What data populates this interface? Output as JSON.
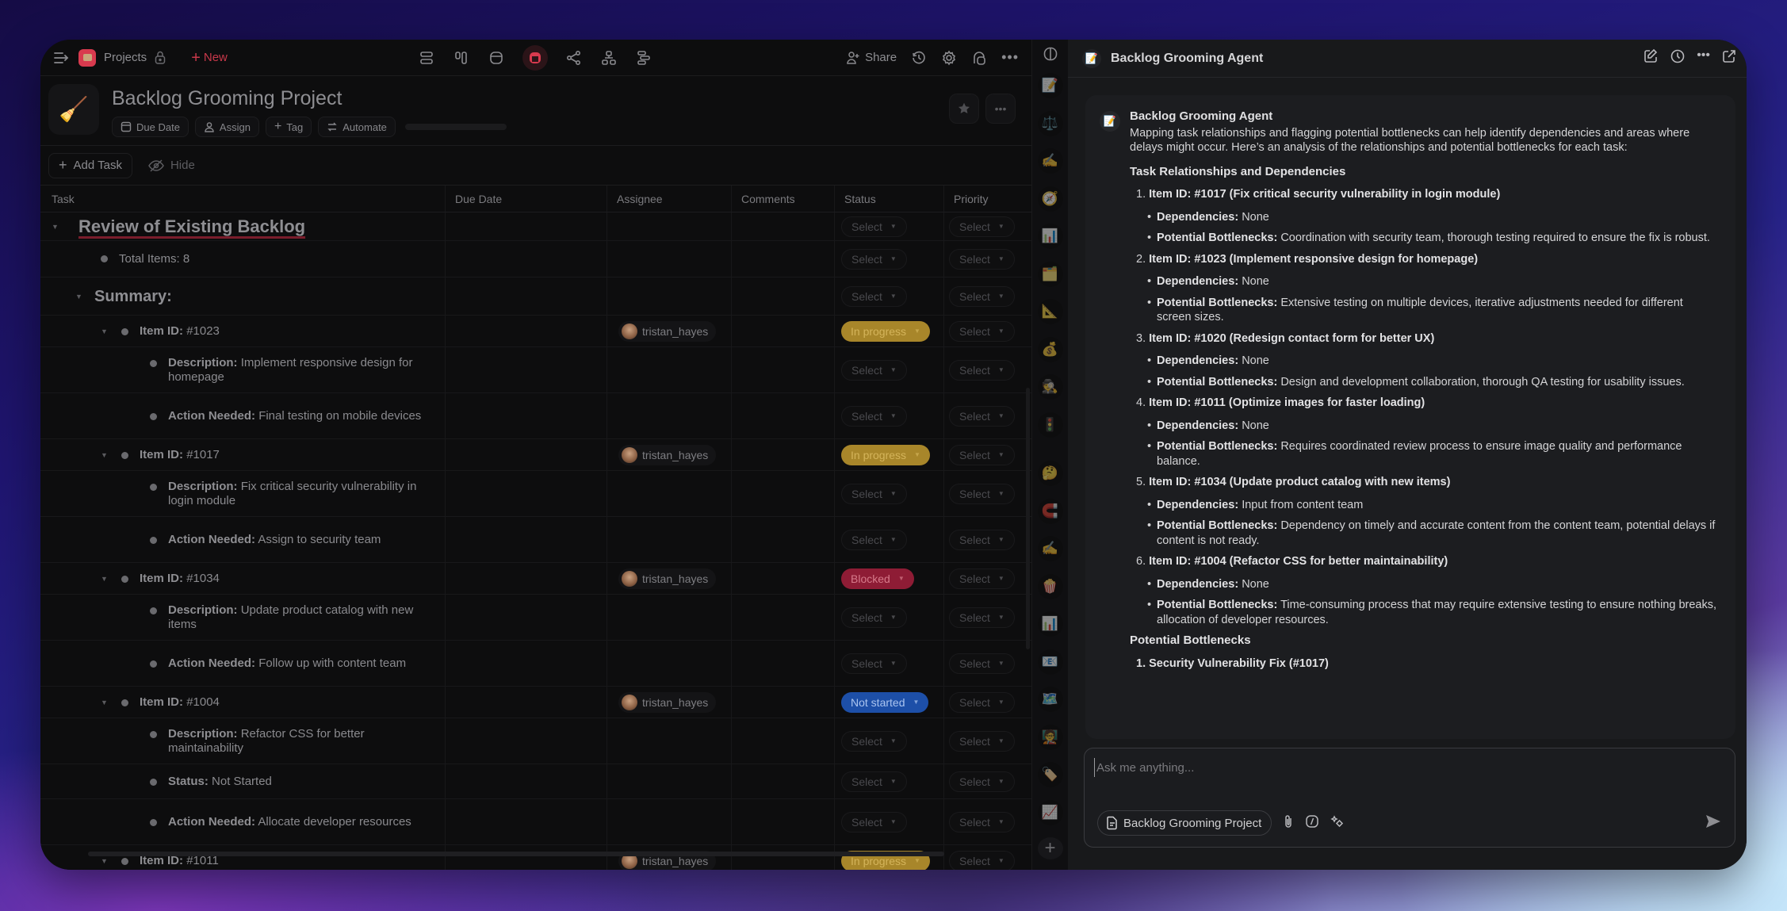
{
  "topbar": {
    "workspace_label": "Projects",
    "new_label": "New",
    "share_label": "Share",
    "views": [
      "list-view",
      "board-view",
      "calendar-view",
      "table-view",
      "graph-view",
      "hierarchy-view",
      "gantt-view"
    ],
    "active_view": "table-view"
  },
  "project": {
    "icon": "🧹",
    "title": "Backlog Grooming Project",
    "actions": {
      "due_date": "Due Date",
      "assign": "Assign",
      "tag": "Tag",
      "automate": "Automate"
    },
    "progress_percent": 0
  },
  "toolbar": {
    "add_task": "Add Task",
    "hide": "Hide"
  },
  "table": {
    "columns": [
      "Task",
      "Due Date",
      "Assignee",
      "Comments",
      "Status",
      "Priority"
    ],
    "select_placeholder": "Select",
    "rows": [
      {
        "type": "h1",
        "text": "Review of Existing Backlog"
      },
      {
        "type": "bullet",
        "text": "Total Items: 8"
      },
      {
        "type": "h2",
        "text": "Summary:"
      },
      {
        "type": "item",
        "label": "Item ID:",
        "text": "#1023",
        "assignee": "tristan_hayes",
        "status": "In progress"
      },
      {
        "type": "sub",
        "label": "Description:",
        "text": "Implement responsive design for homepage"
      },
      {
        "type": "sub",
        "label": "Action Needed:",
        "text": "Final testing on mobile devices"
      },
      {
        "type": "item",
        "label": "Item ID:",
        "text": "#1017",
        "assignee": "tristan_hayes",
        "status": "In progress"
      },
      {
        "type": "sub",
        "label": "Description:",
        "text": "Fix critical security vulnerability in login module"
      },
      {
        "type": "sub",
        "label": "Action Needed:",
        "text": "Assign to security team"
      },
      {
        "type": "item",
        "label": "Item ID:",
        "text": "#1034",
        "assignee": "tristan_hayes",
        "status": "Blocked"
      },
      {
        "type": "sub",
        "label": "Description:",
        "text": "Update product catalog with new items"
      },
      {
        "type": "sub",
        "label": "Action Needed:",
        "text": "Follow up with content team"
      },
      {
        "type": "item",
        "label": "Item ID:",
        "text": "#1004",
        "assignee": "tristan_hayes",
        "status": "Not started"
      },
      {
        "type": "sub",
        "label": "Description:",
        "text": "Refactor CSS for better maintainability"
      },
      {
        "type": "sub",
        "label": "Status:",
        "text": "Not Started"
      },
      {
        "type": "sub",
        "label": "Action Needed:",
        "text": "Allocate developer resources"
      },
      {
        "type": "item",
        "label": "Item ID:",
        "text": "#1011",
        "assignee": "tristan_hayes",
        "status": "In progress"
      }
    ],
    "status_colors": {
      "In progress": "#a8862a",
      "Blocked": "#8e1c35",
      "Not started": "#1d4fa8"
    }
  },
  "agent_strip": {
    "items": [
      {
        "name": "memo",
        "glyph": "📝"
      },
      {
        "name": "balance-scale",
        "glyph": "⚖️"
      },
      {
        "name": "writing-hand",
        "glyph": "✍️"
      },
      {
        "name": "compass",
        "glyph": "🧭"
      },
      {
        "name": "bar-chart",
        "glyph": "📊"
      },
      {
        "name": "file-cabinet",
        "glyph": "🗂️"
      },
      {
        "name": "triangular-ruler",
        "glyph": "📐"
      },
      {
        "name": "money-bag",
        "glyph": "💰"
      },
      {
        "name": "detective",
        "glyph": "🕵️"
      },
      {
        "name": "traffic-light",
        "glyph": "🚦"
      }
    ],
    "items_b": [
      {
        "name": "thinking-face",
        "glyph": "🤔"
      },
      {
        "name": "magnet",
        "glyph": "🧲"
      },
      {
        "name": "writing-hand",
        "glyph": "✍️"
      },
      {
        "name": "popcorn",
        "glyph": "🍿"
      },
      {
        "name": "bar-chart",
        "glyph": "📊"
      },
      {
        "name": "envelope",
        "glyph": "📧"
      },
      {
        "name": "world-map",
        "glyph": "🗺️"
      },
      {
        "name": "teacher",
        "glyph": "🧑‍🏫"
      },
      {
        "name": "label-tag",
        "glyph": "🏷️"
      },
      {
        "name": "chart-increasing",
        "glyph": "📈"
      }
    ]
  },
  "chat": {
    "agent_name": "Backlog Grooming Agent",
    "agent_icon": "📝",
    "message": {
      "sender": "Backlog Grooming Agent",
      "intro": "Mapping task relationships and flagging potential bottlenecks can help identify dependencies and areas where delays might occur. Here’s an analysis of the relationships and potential bottlenecks for each task:",
      "section1": "Task Relationships and Dependencies",
      "items": [
        {
          "n": "1.",
          "title": "Item ID: #1017 (Fix critical security vulnerability in login module)",
          "dep_label": "Dependencies:",
          "dep": "None",
          "bot_label": "Potential Bottlenecks:",
          "bot": "Coordination with security team, thorough testing required to ensure the fix is robust."
        },
        {
          "n": "2.",
          "title": "Item ID: #1023 (Implement responsive design for homepage)",
          "dep_label": "Dependencies:",
          "dep": "None",
          "bot_label": "Potential Bottlenecks:",
          "bot": "Extensive testing on multiple devices, iterative adjustments needed for different screen sizes."
        },
        {
          "n": "3.",
          "title": "Item ID: #1020 (Redesign contact form for better UX)",
          "dep_label": "Dependencies:",
          "dep": "None",
          "bot_label": "Potential Bottlenecks:",
          "bot": "Design and development collaboration, thorough QA testing for usability issues."
        },
        {
          "n": "4.",
          "title": "Item ID: #1011 (Optimize images for faster loading)",
          "dep_label": "Dependencies:",
          "dep": "None",
          "bot_label": "Potential Bottlenecks:",
          "bot": "Requires coordinated review process to ensure image quality and performance balance."
        },
        {
          "n": "5.",
          "title": "Item ID: #1034 (Update product catalog with new items)",
          "dep_label": "Dependencies:",
          "dep": "Input from content team",
          "bot_label": "Potential Bottlenecks:",
          "bot": "Dependency on timely and accurate content from the content team, potential delays if content is not ready."
        },
        {
          "n": "6.",
          "title": "Item ID: #1004 (Refactor CSS for better maintainability)",
          "dep_label": "Dependencies:",
          "dep": "None",
          "bot_label": "Potential Bottlenecks:",
          "bot": "Time-consuming process that may require extensive testing to ensure nothing breaks, allocation of developer resources."
        }
      ],
      "section2": "Potential Bottlenecks",
      "section2_first": "1. Security Vulnerability Fix (#1017)"
    },
    "composer": {
      "placeholder": "Ask me anything...",
      "context_chip": "Backlog Grooming Project"
    }
  }
}
